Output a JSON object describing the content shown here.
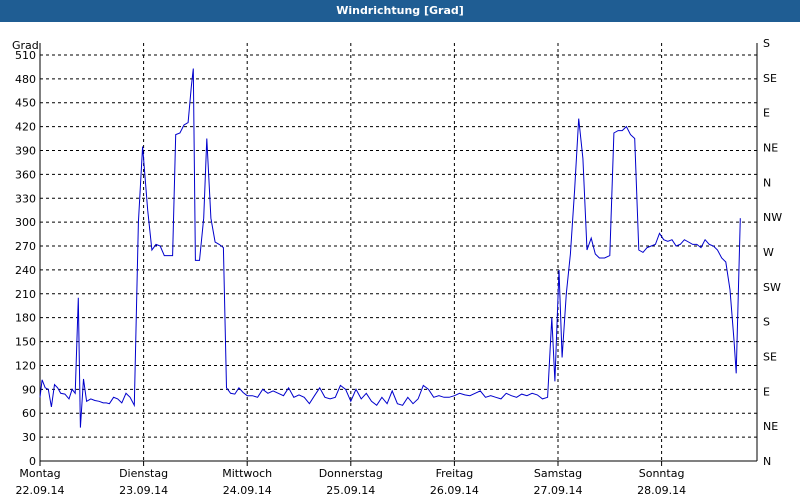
{
  "window": {
    "title": "Windrichtung [Grad]"
  },
  "colors": {
    "titlebar": "#1f5d93",
    "series": "#0000cc",
    "grid": "#000000"
  },
  "chart_data": {
    "type": "line",
    "title": "Windrichtung [Grad]",
    "ylabel": "Grad",
    "ylim": [
      0,
      525
    ],
    "yticks": [
      0,
      30,
      60,
      90,
      120,
      150,
      180,
      210,
      240,
      270,
      300,
      330,
      360,
      390,
      420,
      450,
      480,
      510
    ],
    "right_axis_labels": [
      "N",
      "NE",
      "E",
      "SE",
      "S",
      "SW",
      "W",
      "NW",
      "N",
      "NE",
      "E",
      "SE",
      "S"
    ],
    "grid": true,
    "x_range_days": [
      0,
      7
    ],
    "x_ticks": [
      {
        "day": "Montag",
        "date": "22.09.14"
      },
      {
        "day": "Dienstag",
        "date": "23.09.14"
      },
      {
        "day": "Mittwoch",
        "date": "24.09.14"
      },
      {
        "day": "Donnerstag",
        "date": "25.09.14"
      },
      {
        "day": "Freitag",
        "date": "26.09.14"
      },
      {
        "day": "Samstag",
        "date": "27.09.14"
      },
      {
        "day": "Sonntag",
        "date": "28.09.14"
      }
    ],
    "series": [
      {
        "points": [
          [
            0.0,
            80
          ],
          [
            0.02,
            102
          ],
          [
            0.05,
            92
          ],
          [
            0.08,
            90
          ],
          [
            0.11,
            68
          ],
          [
            0.14,
            96
          ],
          [
            0.17,
            92
          ],
          [
            0.2,
            85
          ],
          [
            0.24,
            84
          ],
          [
            0.28,
            78
          ],
          [
            0.31,
            90
          ],
          [
            0.34,
            85
          ],
          [
            0.37,
            205
          ],
          [
            0.39,
            42
          ],
          [
            0.42,
            103
          ],
          [
            0.45,
            75
          ],
          [
            0.49,
            78
          ],
          [
            0.53,
            76
          ],
          [
            0.57,
            75
          ],
          [
            0.61,
            73
          ],
          [
            0.64,
            73
          ],
          [
            0.67,
            72
          ],
          [
            0.71,
            80
          ],
          [
            0.75,
            78
          ],
          [
            0.79,
            73
          ],
          [
            0.83,
            85
          ],
          [
            0.87,
            80
          ],
          [
            0.91,
            70
          ],
          [
            0.95,
            300
          ],
          [
            0.99,
            395
          ],
          [
            1.04,
            315
          ],
          [
            1.08,
            265
          ],
          [
            1.12,
            272
          ],
          [
            1.16,
            270
          ],
          [
            1.2,
            258
          ],
          [
            1.24,
            258
          ],
          [
            1.28,
            258
          ],
          [
            1.31,
            410
          ],
          [
            1.35,
            412
          ],
          [
            1.39,
            422
          ],
          [
            1.43,
            425
          ],
          [
            1.46,
            470
          ],
          [
            1.48,
            493
          ],
          [
            1.5,
            252
          ],
          [
            1.54,
            252
          ],
          [
            1.58,
            305
          ],
          [
            1.61,
            405
          ],
          [
            1.65,
            305
          ],
          [
            1.69,
            275
          ],
          [
            1.73,
            272
          ],
          [
            1.77,
            268
          ],
          [
            1.8,
            92
          ],
          [
            1.84,
            85
          ],
          [
            1.88,
            84
          ],
          [
            1.92,
            92
          ],
          [
            1.96,
            86
          ],
          [
            2.0,
            82
          ],
          [
            2.05,
            82
          ],
          [
            2.1,
            80
          ],
          [
            2.15,
            90
          ],
          [
            2.2,
            85
          ],
          [
            2.25,
            88
          ],
          [
            2.3,
            85
          ],
          [
            2.35,
            82
          ],
          [
            2.4,
            92
          ],
          [
            2.45,
            80
          ],
          [
            2.5,
            83
          ],
          [
            2.55,
            80
          ],
          [
            2.6,
            72
          ],
          [
            2.65,
            82
          ],
          [
            2.7,
            92
          ],
          [
            2.75,
            80
          ],
          [
            2.8,
            78
          ],
          [
            2.85,
            80
          ],
          [
            2.9,
            95
          ],
          [
            2.95,
            90
          ],
          [
            3.0,
            75
          ],
          [
            3.05,
            90
          ],
          [
            3.1,
            78
          ],
          [
            3.15,
            85
          ],
          [
            3.2,
            75
          ],
          [
            3.25,
            70
          ],
          [
            3.3,
            80
          ],
          [
            3.35,
            72
          ],
          [
            3.4,
            88
          ],
          [
            3.45,
            72
          ],
          [
            3.5,
            70
          ],
          [
            3.55,
            80
          ],
          [
            3.6,
            72
          ],
          [
            3.65,
            78
          ],
          [
            3.7,
            95
          ],
          [
            3.75,
            90
          ],
          [
            3.8,
            80
          ],
          [
            3.85,
            82
          ],
          [
            3.9,
            80
          ],
          [
            3.95,
            80
          ],
          [
            4.0,
            82
          ],
          [
            4.05,
            85
          ],
          [
            4.1,
            83
          ],
          [
            4.15,
            82
          ],
          [
            4.2,
            85
          ],
          [
            4.25,
            88
          ],
          [
            4.3,
            80
          ],
          [
            4.35,
            82
          ],
          [
            4.4,
            80
          ],
          [
            4.45,
            78
          ],
          [
            4.5,
            85
          ],
          [
            4.55,
            82
          ],
          [
            4.6,
            80
          ],
          [
            4.65,
            84
          ],
          [
            4.7,
            82
          ],
          [
            4.75,
            85
          ],
          [
            4.8,
            83
          ],
          [
            4.85,
            78
          ],
          [
            4.9,
            80
          ],
          [
            4.94,
            180
          ],
          [
            4.97,
            100
          ],
          [
            5.01,
            240
          ],
          [
            5.04,
            130
          ],
          [
            5.08,
            210
          ],
          [
            5.12,
            260
          ],
          [
            5.16,
            340
          ],
          [
            5.2,
            430
          ],
          [
            5.24,
            380
          ],
          [
            5.28,
            265
          ],
          [
            5.32,
            280
          ],
          [
            5.36,
            260
          ],
          [
            5.4,
            255
          ],
          [
            5.45,
            255
          ],
          [
            5.5,
            258
          ],
          [
            5.54,
            412
          ],
          [
            5.58,
            415
          ],
          [
            5.62,
            415
          ],
          [
            5.66,
            420
          ],
          [
            5.7,
            410
          ],
          [
            5.74,
            405
          ],
          [
            5.78,
            265
          ],
          [
            5.82,
            262
          ],
          [
            5.86,
            268
          ],
          [
            5.9,
            270
          ],
          [
            5.94,
            272
          ],
          [
            5.98,
            286
          ],
          [
            6.02,
            278
          ],
          [
            6.06,
            276
          ],
          [
            6.1,
            278
          ],
          [
            6.14,
            270
          ],
          [
            6.18,
            272
          ],
          [
            6.22,
            278
          ],
          [
            6.26,
            275
          ],
          [
            6.3,
            272
          ],
          [
            6.34,
            272
          ],
          [
            6.38,
            268
          ],
          [
            6.42,
            278
          ],
          [
            6.46,
            272
          ],
          [
            6.5,
            270
          ],
          [
            6.54,
            265
          ],
          [
            6.58,
            255
          ],
          [
            6.62,
            250
          ],
          [
            6.66,
            215
          ],
          [
            6.7,
            150
          ],
          [
            6.72,
            110
          ],
          [
            6.76,
            305
          ]
        ]
      }
    ]
  }
}
